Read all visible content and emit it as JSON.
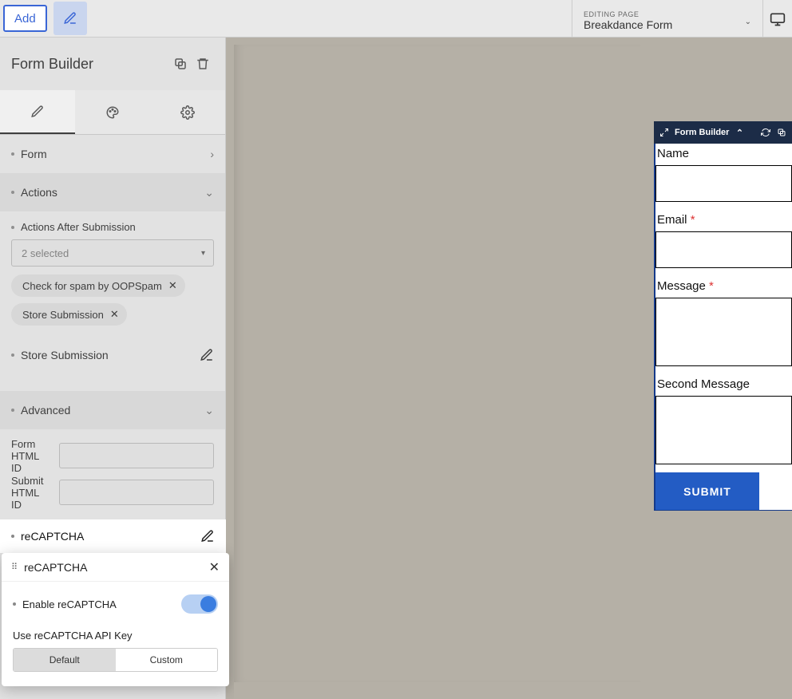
{
  "topbar": {
    "add": "Add",
    "editing_page_label": "EDITING PAGE",
    "editing_page_value": "Breakdance Form"
  },
  "sidebar": {
    "title": "Form Builder",
    "sections": {
      "form": "Form",
      "actions": "Actions",
      "advanced": "Advanced"
    },
    "actions_after_label": "Actions After Submission",
    "actions_selected_text": "2 selected",
    "chips": [
      "Check for spam by OOPSpam",
      "Store Submission"
    ],
    "store_submission": "Store Submission",
    "form_html_id": "Form HTML ID",
    "submit_html_id": "Submit HTML ID",
    "recaptcha": "reCAPTCHA"
  },
  "popup": {
    "title": "reCAPTCHA",
    "enable_label": "Enable reCAPTCHA",
    "api_key_label": "Use reCAPTCHA API Key",
    "seg_default": "Default",
    "seg_custom": "Custom"
  },
  "preview": {
    "toolbar_title": "Form Builder",
    "name": "Name",
    "email": "Email",
    "message": "Message",
    "second_message": "Second Message",
    "submit": "SUBMIT"
  }
}
